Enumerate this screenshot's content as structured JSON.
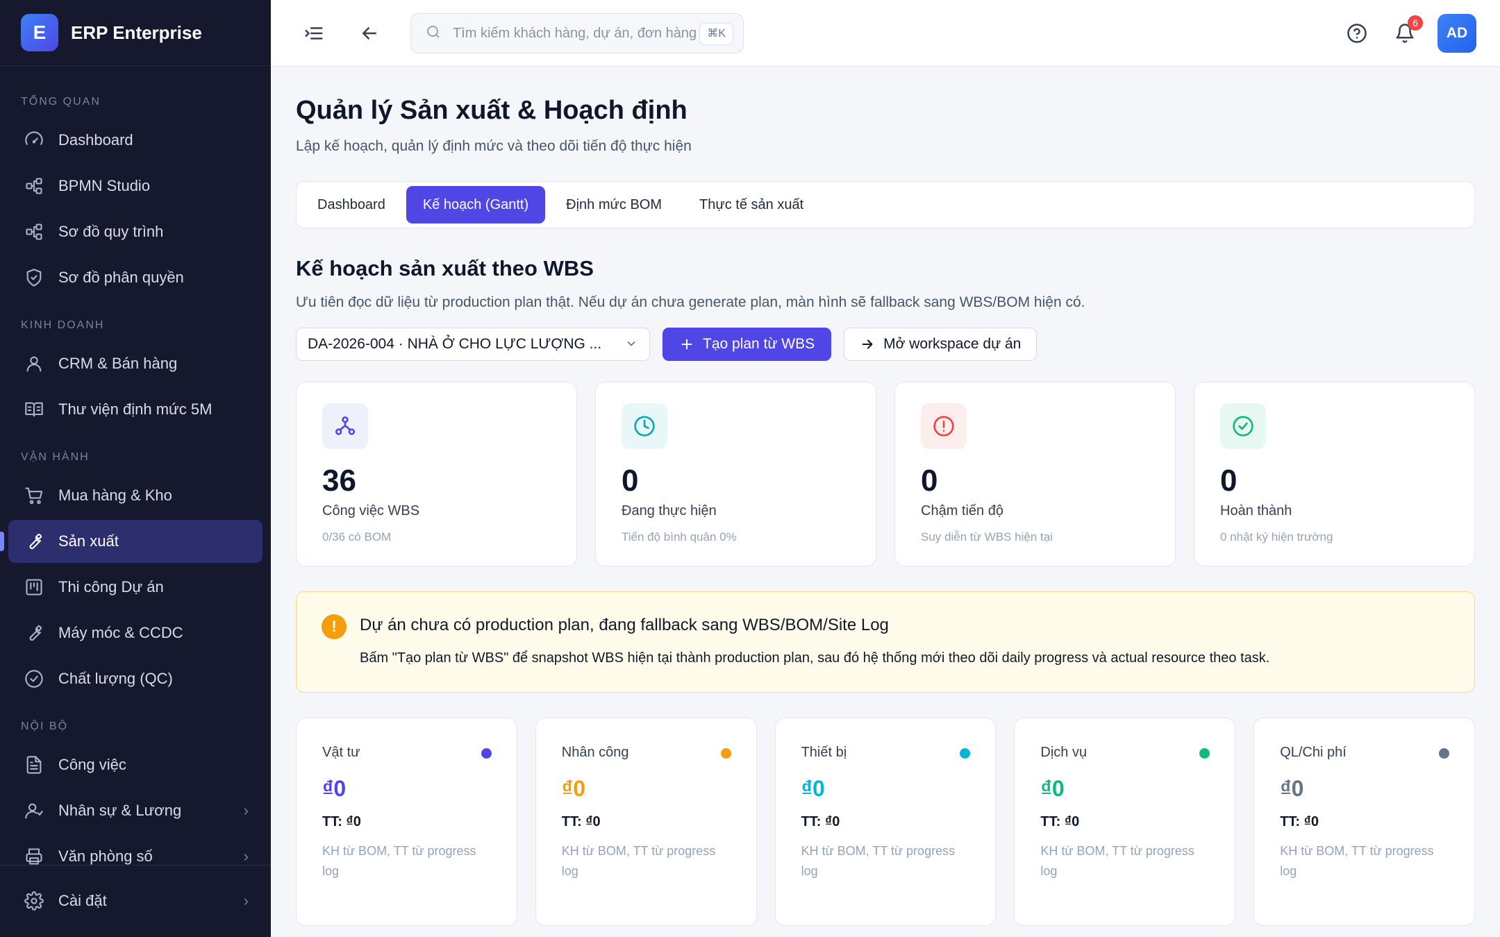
{
  "brand": {
    "logo_letter": "E",
    "name": "ERP Enterprise"
  },
  "sidebar": {
    "sections": [
      {
        "title": "TỔNG QUAN",
        "items": [
          {
            "label": "Dashboard",
            "icon": "dashboard-icon"
          },
          {
            "label": "BPMN Studio",
            "icon": "flow-icon"
          },
          {
            "label": "Sơ đồ quy trình",
            "icon": "flow-icon"
          },
          {
            "label": "Sơ đồ phân quyền",
            "icon": "shield-icon"
          }
        ]
      },
      {
        "title": "KINH DOANH",
        "items": [
          {
            "label": "CRM & Bán hàng",
            "icon": "user-icon"
          },
          {
            "label": "Thư viện định mức 5M",
            "icon": "book-icon"
          }
        ]
      },
      {
        "title": "VẬN HÀNH",
        "items": [
          {
            "label": "Mua hàng & Kho",
            "icon": "cart-icon"
          },
          {
            "label": "Sản xuất",
            "icon": "wrench-icon",
            "active": true
          },
          {
            "label": "Thi công Dự án",
            "icon": "kanban-icon"
          },
          {
            "label": "Máy móc & CCDC",
            "icon": "wrench-icon"
          },
          {
            "label": "Chất lượng (QC)",
            "icon": "check-circle-icon"
          }
        ]
      },
      {
        "title": "NỘI BỘ",
        "items": [
          {
            "label": "Công việc",
            "icon": "file-icon"
          },
          {
            "label": "Nhân sự & Lương",
            "icon": "users-icon",
            "chevron": true
          },
          {
            "label": "Văn phòng số",
            "icon": "printer-icon",
            "chevron": true
          }
        ]
      }
    ],
    "footer": {
      "label": "Cài đặt",
      "icon": "gear-icon"
    }
  },
  "topbar": {
    "search_placeholder": "Tìm kiếm khách hàng, dự án, đơn hàng...",
    "shortcut": "⌘K",
    "notification_count": "6",
    "avatar": "AD"
  },
  "page": {
    "title": "Quản lý Sản xuất & Hoạch định",
    "subtitle": "Lập kế hoạch, quản lý định mức và theo dõi tiến độ thực hiện",
    "tabs": [
      "Dashboard",
      "Kế hoạch (Gantt)",
      "Định mức BOM",
      "Thực tế sản xuất"
    ],
    "active_tab": 1
  },
  "plan": {
    "title": "Kế hoạch sản xuất theo WBS",
    "description": "Ưu tiên đọc dữ liệu từ production plan thật. Nếu dự án chưa generate plan, màn hình sẽ fallback sang WBS/BOM hiện có.",
    "project_select": "DA-2026-004 · NHÀ Ở CHO LỰC LƯỢNG ...",
    "create_button": "Tạo plan từ WBS",
    "workspace_button": "Mở workspace dự án"
  },
  "stats": [
    {
      "value": "36",
      "label": "Công việc WBS",
      "hint": "0/36 có BOM",
      "icon": "network-icon",
      "color": "#4f46e5",
      "bg": "#eef0fb"
    },
    {
      "value": "0",
      "label": "Đang thực hiện",
      "hint": "Tiến độ bình quân 0%",
      "icon": "clock-icon",
      "color": "#0ea5b7",
      "bg": "#e8f7f8"
    },
    {
      "value": "0",
      "label": "Chậm tiến độ",
      "hint": "Suy diễn từ WBS hiện tại",
      "icon": "alert-circle-icon",
      "color": "#ef4444",
      "bg": "#fdeeee"
    },
    {
      "value": "0",
      "label": "Hoàn thành",
      "hint": "0 nhật ký hiện trường",
      "icon": "check-circle-icon",
      "color": "#10b981",
      "bg": "#e7f7f1"
    }
  ],
  "alert": {
    "icon": "!",
    "title": "Dự án chưa có production plan, đang fallback sang WBS/BOM/Site Log",
    "description": "Bấm \"Tạo plan từ WBS\" để snapshot WBS hiện tại thành production plan, sau đó hệ thống mới theo dõi daily progress và actual resource theo task."
  },
  "costs": [
    {
      "name": "Vật tư",
      "value": "₫0",
      "tt": "TT: ₫0",
      "note": "KH từ BOM, TT từ progress log",
      "color": "#4f46e5"
    },
    {
      "name": "Nhân công",
      "value": "₫0",
      "tt": "TT: ₫0",
      "note": "KH từ BOM, TT từ progress log",
      "color": "#f59e0b"
    },
    {
      "name": "Thiết bị",
      "value": "₫0",
      "tt": "TT: ₫0",
      "note": "KH từ BOM, TT từ progress log",
      "color": "#06b6d4"
    },
    {
      "name": "Dịch vụ",
      "value": "₫0",
      "tt": "TT: ₫0",
      "note": "KH từ BOM, TT từ progress log",
      "color": "#10b981"
    },
    {
      "name": "QL/Chi phí",
      "value": "₫0",
      "tt": "TT: ₫0",
      "note": "KH từ BOM, TT từ progress log",
      "color": "#64748b"
    }
  ]
}
